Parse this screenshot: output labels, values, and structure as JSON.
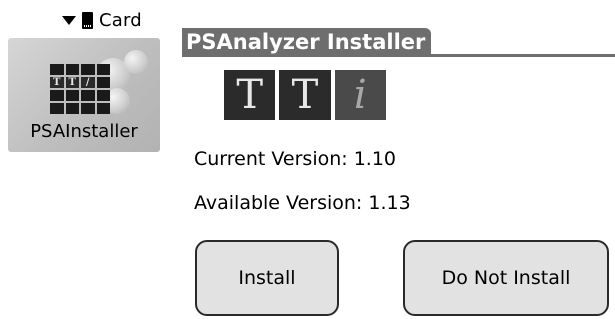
{
  "launcher": {
    "category_label": "Card",
    "app_label": "PSAInstaller",
    "icons": {
      "category_arrow": "triangle-down-icon",
      "card": "sd-card-icon",
      "app_logo": "tti-grid-logo-icon"
    }
  },
  "dialog": {
    "title": "PSAnalyzer Installer",
    "logo_letters": [
      "T",
      "T",
      "i"
    ],
    "current_version_text": "Current Version: 1.10",
    "available_version_text": "Available Version: 1.13",
    "buttons": {
      "install_label": "Install",
      "do_not_install_label": "Do Not Install"
    }
  },
  "colors": {
    "title_bar": "#6e6e6e",
    "button_bg": "#e2e2e2",
    "tile_bg": "#c4c4c4"
  }
}
